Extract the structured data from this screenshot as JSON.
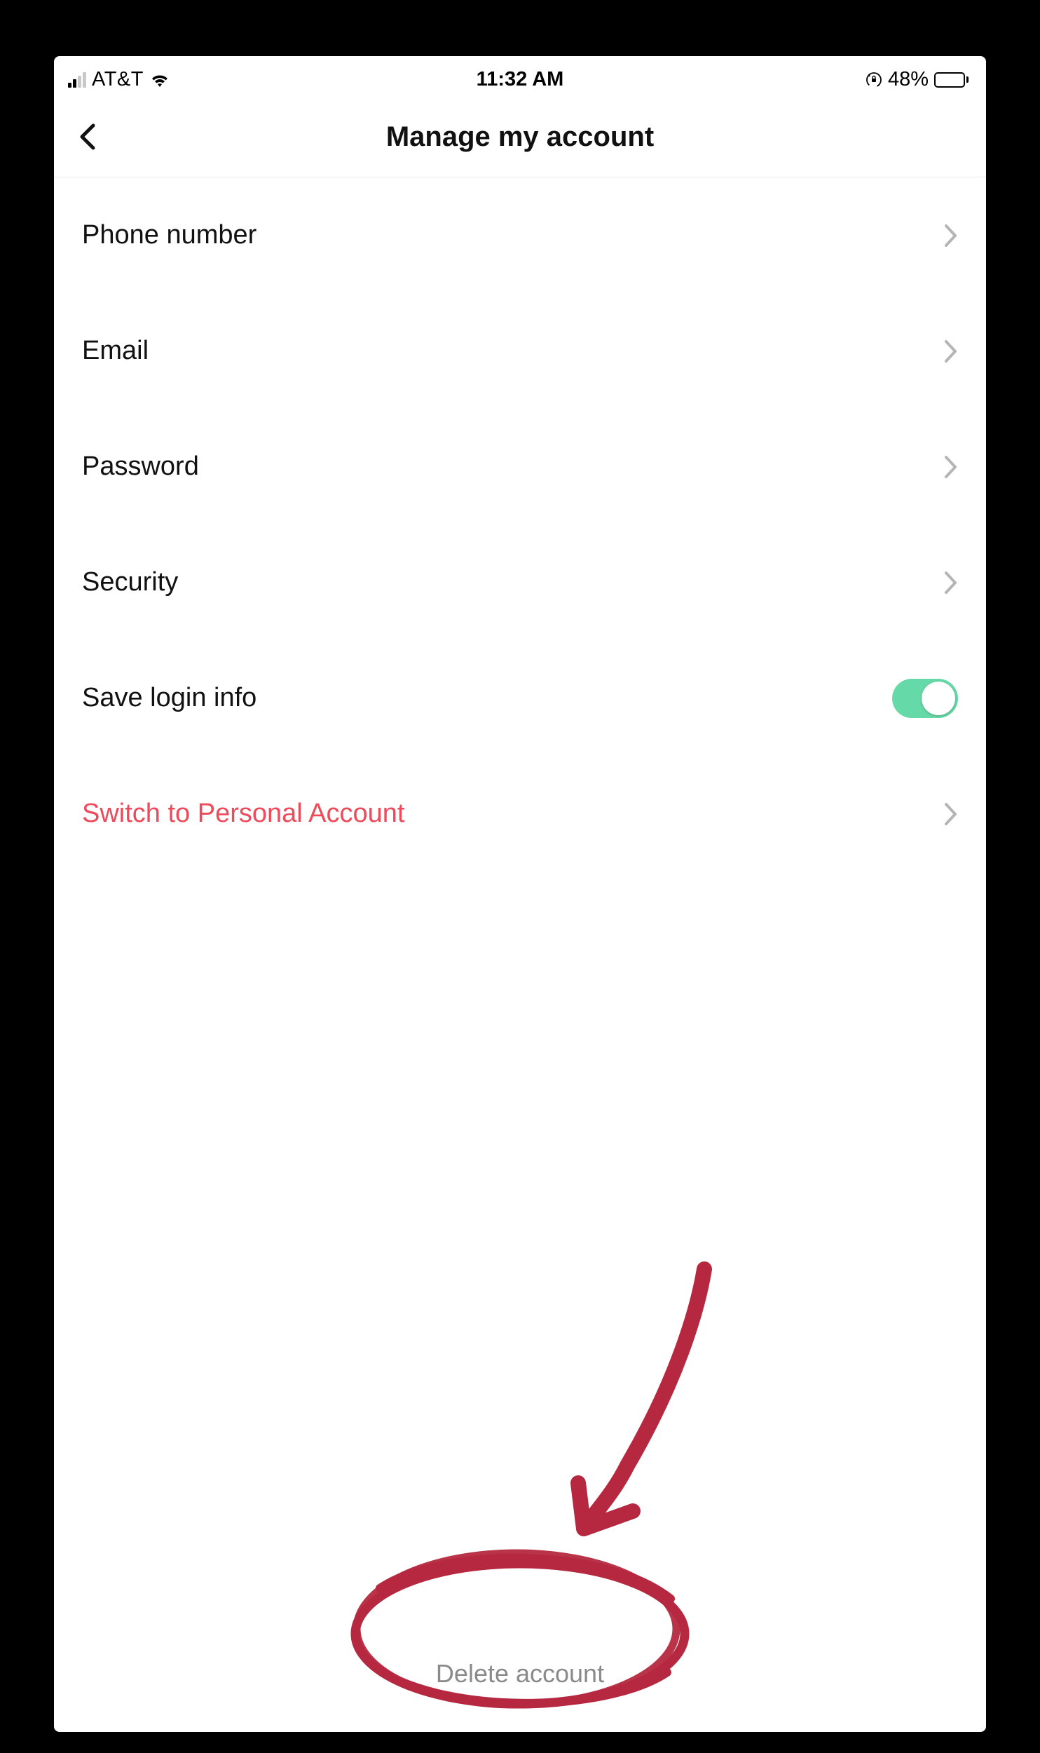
{
  "statusBar": {
    "carrier": "AT&T",
    "time": "11:32 AM",
    "batteryPercent": "48%"
  },
  "header": {
    "title": "Manage my account"
  },
  "rows": {
    "phone": "Phone number",
    "email": "Email",
    "password": "Password",
    "security": "Security",
    "saveLogin": "Save login info",
    "switch": "Switch to Personal Account"
  },
  "saveLoginToggle": true,
  "footer": {
    "delete": "Delete account"
  },
  "annotation": {
    "highlightColor": "#b5283f"
  }
}
